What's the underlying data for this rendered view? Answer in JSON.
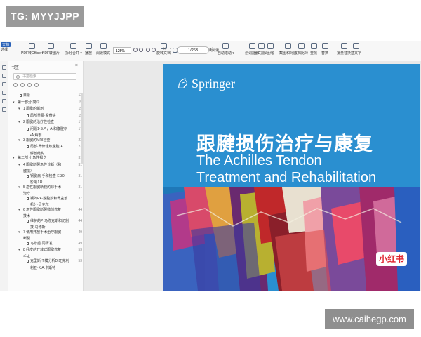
{
  "watermarks": {
    "top": "TG: MYYJJPP",
    "bottom": "www.caihegp.com"
  },
  "toolbar": {
    "first": {
      "tag": "文档",
      "label": "选择"
    },
    "items": [
      {
        "icon": "pdf-convert-icon",
        "label": "PDF转Office ▾"
      },
      {
        "icon": "pdf-image-icon",
        "label": "PDF转图片"
      },
      {
        "icon": "split-merge-icon",
        "label": "拆分合并 ▾"
      },
      {
        "icon": "play-icon",
        "label": "播放"
      },
      {
        "icon": "read-mode-icon",
        "label": "阅读模式"
      },
      {
        "icon": "rotate-doc-icon",
        "label": "旋转文档"
      },
      {
        "icon": "single-page-icon",
        "label": "单页"
      },
      {
        "icon": "double-page-icon",
        "label": "双页 ▾"
      },
      {
        "icon": "continuous-read-icon",
        "label": "连续阅读"
      },
      {
        "icon": "auto-scroll-icon",
        "label": "自动滚动 ▾"
      },
      {
        "icon": "translate-icon",
        "label": "划词翻译"
      },
      {
        "icon": "full-translate-icon",
        "label": "全文翻译"
      },
      {
        "icon": "compress-icon",
        "label": "压缩"
      },
      {
        "icon": "screenshot-compare-icon",
        "label": "截图和对比"
      },
      {
        "icon": "text-compare-icon",
        "label": "文档比对"
      },
      {
        "icon": "find-icon",
        "label": "查找"
      },
      {
        "icon": "replace-icon",
        "label": "替换"
      },
      {
        "icon": "batch-replace-icon",
        "label": "批量替换"
      },
      {
        "icon": "insert-text-icon",
        "label": "插文字"
      }
    ],
    "zoom": "125%",
    "page": "1/263"
  },
  "sidebar": {
    "title": "书签",
    "search_placeholder": "书签检索",
    "items": [
      {
        "label": "目录",
        "page": "13",
        "level": 1,
        "kind": "doc"
      },
      {
        "label": "第一部分 简介",
        "page": "15",
        "level": 0,
        "kind": "folder"
      },
      {
        "label": "1 跟腱的解剖",
        "page": "15",
        "level": 1,
        "kind": "folder"
      },
      {
        "label": "局部重要·股骨头",
        "page": "15",
        "level": 2,
        "kind": "doc"
      },
      {
        "label": "2 跟腱的治疗性检查",
        "page": "17",
        "level": 1,
        "kind": "folder"
      },
      {
        "label": "问题1·S.P.，A.和腹腔积",
        "page": "17",
        "level": 2,
        "kind": "doc"
      },
      {
        "label": "•A.解剖",
        "page": "",
        "level": 2,
        "kind": "cont"
      },
      {
        "label": "3 跟腱的MRI检查",
        "page": "23",
        "level": 1,
        "kind": "folder"
      },
      {
        "label": "局部·骨修组织腹腔·A.",
        "page": "23",
        "level": 2,
        "kind": "doc"
      },
      {
        "label": "解剖结构",
        "page": "",
        "level": 2,
        "kind": "cont"
      },
      {
        "label": "第二部分 急性损伤",
        "page": "31",
        "level": 0,
        "kind": "folder"
      },
      {
        "label": "4 跟腱断裂急性诊断（和",
        "page": "31",
        "level": 1,
        "kind": "folder"
      },
      {
        "label": "腱损）",
        "page": "",
        "level": 1,
        "kind": "cont"
      },
      {
        "label": "钢腱病·手和检查·E.30",
        "page": "31",
        "level": 2,
        "kind": "doc"
      },
      {
        "label": "影响J.R.",
        "page": "",
        "level": 2,
        "kind": "cont"
      },
      {
        "label": "5 急性跟腱断裂的非手术",
        "page": "31",
        "level": 1,
        "kind": "folder"
      },
      {
        "label": "治疗",
        "page": "",
        "level": 1,
        "kind": "cont"
      },
      {
        "label": "钢的RF·腹腔膜和骨盆部",
        "page": "37",
        "level": 2,
        "kind": "doc"
      },
      {
        "label": "机分·贝克尔",
        "page": "",
        "level": 2,
        "kind": "cont"
      },
      {
        "label": "6 急性跟腱断裂微创修复",
        "page": "44",
        "level": 1,
        "kind": "folder"
      },
      {
        "label": "技术",
        "page": "",
        "level": 1,
        "kind": "cont"
      },
      {
        "label": "维护的P·马修克斯和切割",
        "page": "44",
        "level": 2,
        "kind": "doc"
      },
      {
        "label": "技·马修斯",
        "page": "",
        "level": 2,
        "kind": "cont"
      },
      {
        "label": "7 使用开放手术治疗跟腱",
        "page": "49",
        "level": 1,
        "kind": "folder"
      },
      {
        "label": "断裂",
        "page": "",
        "level": 1,
        "kind": "cont"
      },
      {
        "label": "马修后·同研发",
        "page": "49",
        "level": 2,
        "kind": "doc"
      },
      {
        "label": "8 经皮的开放式跟腱修复",
        "page": "53",
        "level": 1,
        "kind": "folder"
      },
      {
        "label": "手术",
        "page": "",
        "level": 1,
        "kind": "cont"
      },
      {
        "label": "克里斯·T.模分析D.旺克利",
        "page": "53",
        "level": 2,
        "kind": "doc"
      },
      {
        "label": "利亚·K.A.卡斯特",
        "page": "",
        "level": 2,
        "kind": "cont"
      }
    ]
  },
  "cover": {
    "publisher": "Springer",
    "title_cn": "跟腱损伤治疗与康复",
    "title_en_line1": "The Achilles Tendon",
    "title_en_line2": "Treatment and Rehabilitation",
    "badge": "小红书"
  },
  "colors": {
    "cover_bg": "#2a8fd0",
    "accent": "#2b63b8",
    "badge_text": "#e0222e"
  }
}
